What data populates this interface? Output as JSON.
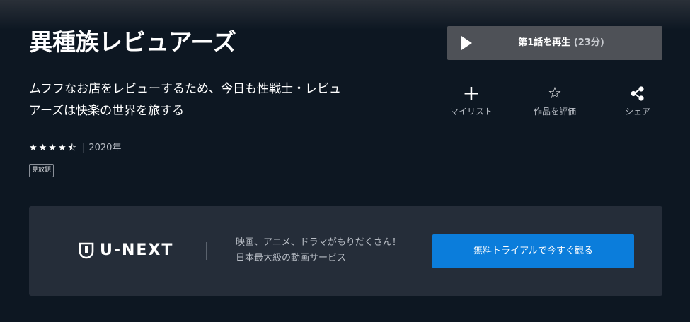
{
  "title": "異種族レビュアーズ",
  "play": {
    "label": "第1話を再生",
    "duration": "(23分)"
  },
  "description": {
    "line1": "ムフフなお店をレビューするため、今日も性戦士・レビュ",
    "line2": "アーズは快楽の世界を旅する"
  },
  "actions": {
    "mylist": {
      "icon": "+",
      "label": "マイリスト"
    },
    "rate": {
      "icon": "☆",
      "label": "作品を評価"
    },
    "share": {
      "label": "シェア"
    }
  },
  "meta": {
    "rating": 4.5,
    "stars": "★★★★",
    "half_star": "⯪",
    "separator": "|",
    "year": "2020年"
  },
  "badge": "見放題",
  "promo": {
    "logo_text": "U-NEXT",
    "line1": "映画、アニメ、ドラマがもりだくさん！",
    "line2": "日本最大級の動画サービス",
    "cta": "無料トライアルで今すぐ観る"
  },
  "colors": {
    "background": "#0d1722",
    "panel": "#252d39",
    "play_button": "#4e5157",
    "cta": "#0b7ddb"
  }
}
